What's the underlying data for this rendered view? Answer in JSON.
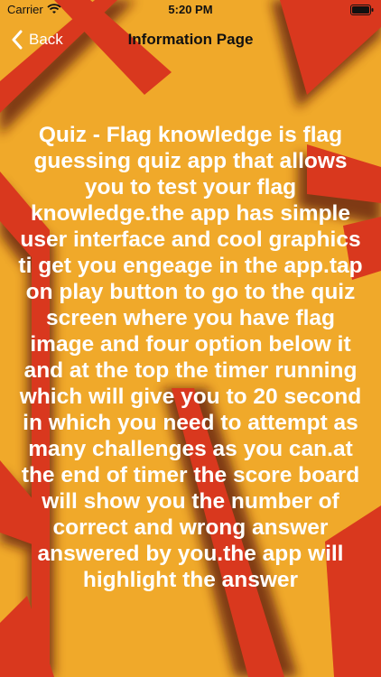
{
  "status_bar": {
    "carrier": "Carrier",
    "time": "5:20 PM",
    "icons": [
      "wifi-icon",
      "battery-icon"
    ]
  },
  "nav": {
    "back_label": "Back",
    "title": "Information Page"
  },
  "content": {
    "description": "Quiz - Flag knowledge is flag guessing quiz app that allows you to test your flag knowledge.the app has simple user interface and cool graphics ti get you engeage in the app.tap on play button to go to the quiz screen where you have flag image and four option below it and at the top the timer running which will give you to 20 second in which you need to attempt as many challenges as you can.at the end of timer the score board will show you the number of correct and wrong answer answered by you.the app will highlight the answer"
  },
  "colors": {
    "background": "#f0a92a",
    "accent": "#d9381e",
    "shadow": "#7a1a10",
    "text": "#ffffff"
  }
}
